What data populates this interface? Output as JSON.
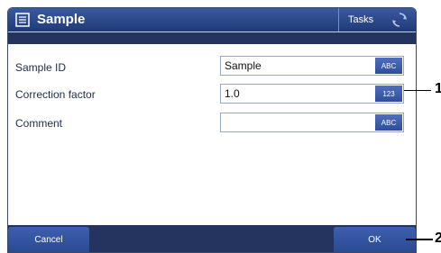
{
  "window": {
    "title": "Sample",
    "title_icon": "list-icon",
    "tasks_label": "Tasks",
    "sync_icon": "sync-icon"
  },
  "form": {
    "rows": [
      {
        "label": "Sample ID",
        "value": "Sample",
        "keyboard": "ABC"
      },
      {
        "label": "Correction factor",
        "value": "1.0",
        "keyboard": "123"
      },
      {
        "label": "Comment",
        "value": "",
        "keyboard": "ABC"
      }
    ]
  },
  "footer": {
    "cancel_label": "Cancel",
    "ok_label": "OK"
  },
  "callouts": {
    "one": "1",
    "two": "2"
  },
  "colors": {
    "title_bar": "#2a4a8e",
    "dark_bar": "#25345e",
    "button": "#3a5aa8"
  }
}
